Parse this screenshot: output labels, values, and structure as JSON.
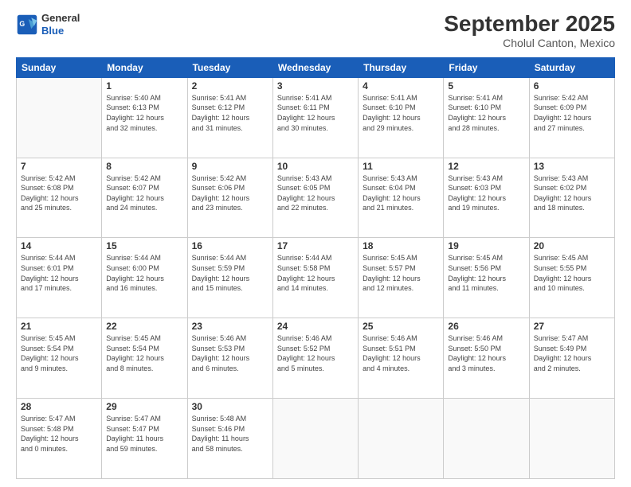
{
  "logo": {
    "line1": "General",
    "line2": "Blue"
  },
  "header": {
    "month": "September 2025",
    "location": "Cholul Canton, Mexico"
  },
  "weekdays": [
    "Sunday",
    "Monday",
    "Tuesday",
    "Wednesday",
    "Thursday",
    "Friday",
    "Saturday"
  ],
  "weeks": [
    [
      {
        "day": "",
        "info": ""
      },
      {
        "day": "1",
        "info": "Sunrise: 5:40 AM\nSunset: 6:13 PM\nDaylight: 12 hours\nand 32 minutes."
      },
      {
        "day": "2",
        "info": "Sunrise: 5:41 AM\nSunset: 6:12 PM\nDaylight: 12 hours\nand 31 minutes."
      },
      {
        "day": "3",
        "info": "Sunrise: 5:41 AM\nSunset: 6:11 PM\nDaylight: 12 hours\nand 30 minutes."
      },
      {
        "day": "4",
        "info": "Sunrise: 5:41 AM\nSunset: 6:10 PM\nDaylight: 12 hours\nand 29 minutes."
      },
      {
        "day": "5",
        "info": "Sunrise: 5:41 AM\nSunset: 6:10 PM\nDaylight: 12 hours\nand 28 minutes."
      },
      {
        "day": "6",
        "info": "Sunrise: 5:42 AM\nSunset: 6:09 PM\nDaylight: 12 hours\nand 27 minutes."
      }
    ],
    [
      {
        "day": "7",
        "info": "Sunrise: 5:42 AM\nSunset: 6:08 PM\nDaylight: 12 hours\nand 25 minutes."
      },
      {
        "day": "8",
        "info": "Sunrise: 5:42 AM\nSunset: 6:07 PM\nDaylight: 12 hours\nand 24 minutes."
      },
      {
        "day": "9",
        "info": "Sunrise: 5:42 AM\nSunset: 6:06 PM\nDaylight: 12 hours\nand 23 minutes."
      },
      {
        "day": "10",
        "info": "Sunrise: 5:43 AM\nSunset: 6:05 PM\nDaylight: 12 hours\nand 22 minutes."
      },
      {
        "day": "11",
        "info": "Sunrise: 5:43 AM\nSunset: 6:04 PM\nDaylight: 12 hours\nand 21 minutes."
      },
      {
        "day": "12",
        "info": "Sunrise: 5:43 AM\nSunset: 6:03 PM\nDaylight: 12 hours\nand 19 minutes."
      },
      {
        "day": "13",
        "info": "Sunrise: 5:43 AM\nSunset: 6:02 PM\nDaylight: 12 hours\nand 18 minutes."
      }
    ],
    [
      {
        "day": "14",
        "info": "Sunrise: 5:44 AM\nSunset: 6:01 PM\nDaylight: 12 hours\nand 17 minutes."
      },
      {
        "day": "15",
        "info": "Sunrise: 5:44 AM\nSunset: 6:00 PM\nDaylight: 12 hours\nand 16 minutes."
      },
      {
        "day": "16",
        "info": "Sunrise: 5:44 AM\nSunset: 5:59 PM\nDaylight: 12 hours\nand 15 minutes."
      },
      {
        "day": "17",
        "info": "Sunrise: 5:44 AM\nSunset: 5:58 PM\nDaylight: 12 hours\nand 14 minutes."
      },
      {
        "day": "18",
        "info": "Sunrise: 5:45 AM\nSunset: 5:57 PM\nDaylight: 12 hours\nand 12 minutes."
      },
      {
        "day": "19",
        "info": "Sunrise: 5:45 AM\nSunset: 5:56 PM\nDaylight: 12 hours\nand 11 minutes."
      },
      {
        "day": "20",
        "info": "Sunrise: 5:45 AM\nSunset: 5:55 PM\nDaylight: 12 hours\nand 10 minutes."
      }
    ],
    [
      {
        "day": "21",
        "info": "Sunrise: 5:45 AM\nSunset: 5:54 PM\nDaylight: 12 hours\nand 9 minutes."
      },
      {
        "day": "22",
        "info": "Sunrise: 5:45 AM\nSunset: 5:54 PM\nDaylight: 12 hours\nand 8 minutes."
      },
      {
        "day": "23",
        "info": "Sunrise: 5:46 AM\nSunset: 5:53 PM\nDaylight: 12 hours\nand 6 minutes."
      },
      {
        "day": "24",
        "info": "Sunrise: 5:46 AM\nSunset: 5:52 PM\nDaylight: 12 hours\nand 5 minutes."
      },
      {
        "day": "25",
        "info": "Sunrise: 5:46 AM\nSunset: 5:51 PM\nDaylight: 12 hours\nand 4 minutes."
      },
      {
        "day": "26",
        "info": "Sunrise: 5:46 AM\nSunset: 5:50 PM\nDaylight: 12 hours\nand 3 minutes."
      },
      {
        "day": "27",
        "info": "Sunrise: 5:47 AM\nSunset: 5:49 PM\nDaylight: 12 hours\nand 2 minutes."
      }
    ],
    [
      {
        "day": "28",
        "info": "Sunrise: 5:47 AM\nSunset: 5:48 PM\nDaylight: 12 hours\nand 0 minutes."
      },
      {
        "day": "29",
        "info": "Sunrise: 5:47 AM\nSunset: 5:47 PM\nDaylight: 11 hours\nand 59 minutes."
      },
      {
        "day": "30",
        "info": "Sunrise: 5:48 AM\nSunset: 5:46 PM\nDaylight: 11 hours\nand 58 minutes."
      },
      {
        "day": "",
        "info": ""
      },
      {
        "day": "",
        "info": ""
      },
      {
        "day": "",
        "info": ""
      },
      {
        "day": "",
        "info": ""
      }
    ]
  ]
}
